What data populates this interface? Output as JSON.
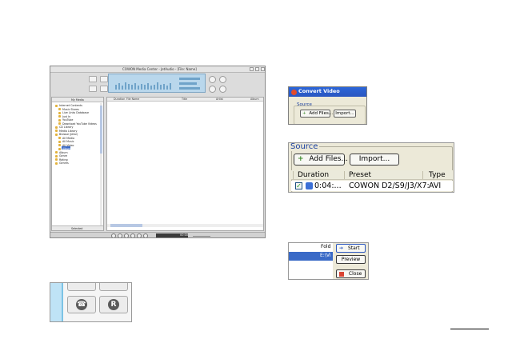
{
  "main_window": {
    "title": "COWON Media Center - JetAudio - [File: Name]",
    "tree_header": "My Media",
    "tree_footer": "Selected",
    "tree_items": [
      "Internet Contents",
      "Music Stores",
      "Live Links Database",
      "Just In",
      "YouTube",
      "Download YouTube Videos",
      "CD Library",
      "Media Library",
      "Browse (Jetar)",
      "All Media",
      "All Music",
      "All Video",
      "Album",
      "Album",
      "Genre",
      "Rating",
      "Genres"
    ],
    "list_columns": [
      "Duration",
      "File Name",
      "Title",
      "Artist",
      "Album"
    ],
    "time_readout": "00:00"
  },
  "convert_small": {
    "title": "Convert Video",
    "source_label": "Source",
    "add_files": "Add Files...",
    "import": "Import..."
  },
  "convert_large": {
    "source_label": "Source",
    "add_files": "Add Files...",
    "import": "Import...",
    "columns": [
      "Duration",
      "Preset",
      "Type"
    ],
    "row": {
      "duration": "0:04:...",
      "preset": "COWON D2/S9/J3/X7:",
      "type": "AVI"
    }
  },
  "start_menu": {
    "folder_col": "Fold",
    "selected_row": "E:\\Vi",
    "start": "Start",
    "preview": "Preview",
    "close": "Close"
  },
  "crop_left": {
    "glyph": "R"
  },
  "colors": {
    "xp_titlebar": "#2a56c0",
    "selection": "#3a6ac7",
    "panel": "#ece9d8"
  }
}
